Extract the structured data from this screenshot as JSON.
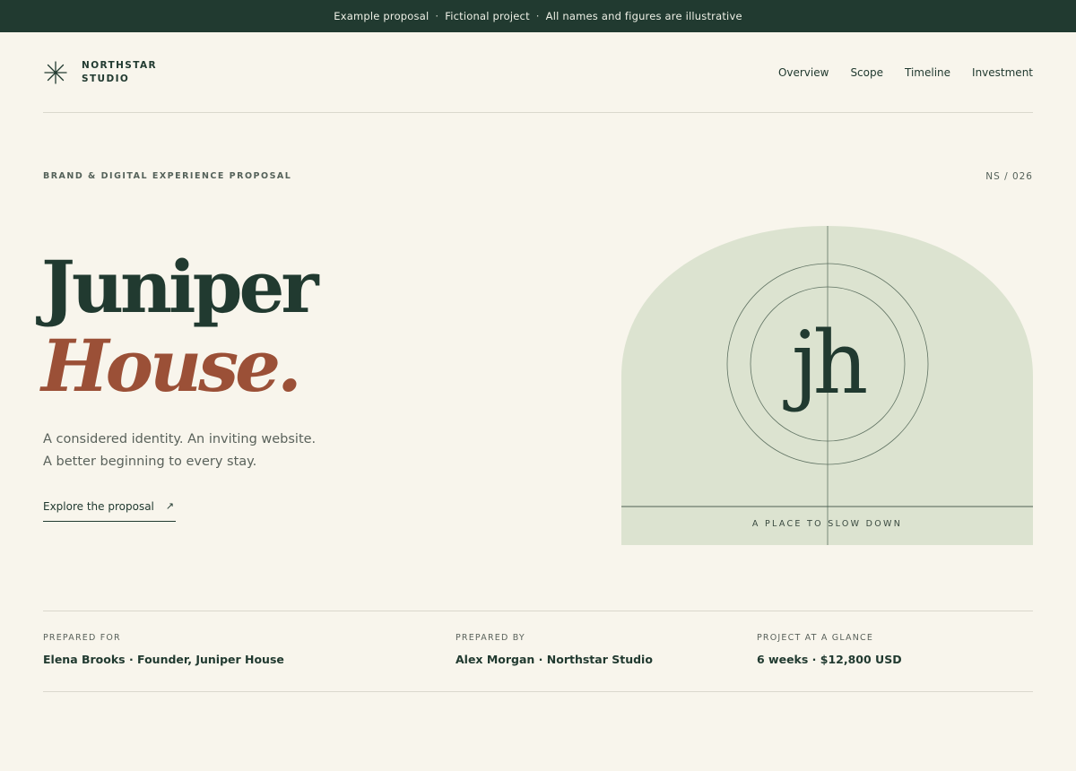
{
  "announcement": {
    "items": [
      "Example proposal",
      "Fictional project",
      "All names and figures are illustrative"
    ],
    "separator": "·"
  },
  "brand": {
    "icon": "asterisk-star-icon",
    "name_line1": "NORTHSTAR",
    "name_line2": "STUDIO"
  },
  "nav": {
    "items": [
      {
        "label": "Overview"
      },
      {
        "label": "Scope"
      },
      {
        "label": "Timeline"
      },
      {
        "label": "Investment"
      }
    ]
  },
  "hero": {
    "eyebrow": "BRAND & DIGITAL EXPERIENCE PROPOSAL",
    "reference": "NS / 026",
    "title_line1": "Juniper",
    "title_line2": "House.",
    "subtitle_line1": "A considered identity. An inviting website.",
    "subtitle_line2": "A better beginning to every stay.",
    "cta_label": "Explore the proposal",
    "cta_icon": "arrow-up-right-icon"
  },
  "artwork": {
    "monogram": "jh",
    "tagline": "A PLACE TO SLOW DOWN"
  },
  "details": [
    {
      "label": "PREPARED FOR",
      "value": "Elena Brooks · Founder, Juniper House"
    },
    {
      "label": "PREPARED BY",
      "value": "Alex Morgan · Northstar Studio"
    },
    {
      "label": "PROJECT AT A GLANCE",
      "value": "6 weeks · $12,800 USD"
    }
  ],
  "colors": {
    "background": "#f8f5ec",
    "primary": "#213a30",
    "accent": "#9b5037",
    "sage": "#dce3d0"
  }
}
